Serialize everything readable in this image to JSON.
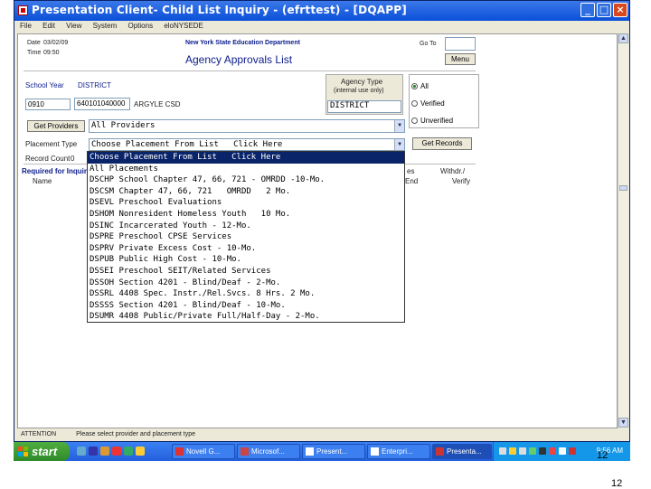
{
  "window": {
    "title": "Presentation Client- Child List Inquiry - (efrttest) - [DQAPP]",
    "menu": [
      "File",
      "Edit",
      "View",
      "System",
      "Options",
      "eloNYSEDE"
    ]
  },
  "header": {
    "date_label": "Date",
    "date_value": "03/02/09",
    "time_label": "Time",
    "time_value": "09:50",
    "department": "New York State Education Department",
    "page_title": "Agency Approvals List",
    "goto_label": "Go To",
    "goto_value": "",
    "menu_button": "Menu"
  },
  "selection": {
    "school_year_label": "School Year",
    "district_label": "DISTRICT",
    "school_year": "0910",
    "district_code": "640101040000",
    "district_name": "ARGYLE CSD",
    "agency_type_label": "Agency Type",
    "agency_type_sub": "(internal use only)",
    "agency_type_value": "DISTRICT",
    "get_providers_button": "Get Providers",
    "providers_value": "All Providers",
    "placement_type_label": "Placement Type",
    "placement_value": "Choose Placement From List   Click Here",
    "get_records_button": "Get Records",
    "record_count_label": "Record Count",
    "record_count": "0",
    "required_label": "Required for Inquiry",
    "name_col": "Name",
    "dates_col": "es",
    "end_col": "End",
    "withdraw_col": "Withdr./",
    "verify_col": "Verify"
  },
  "status_filter": {
    "options": [
      {
        "label": "All",
        "selected": true
      },
      {
        "label": "Verified",
        "selected": false
      },
      {
        "label": "Unverified",
        "selected": false
      }
    ]
  },
  "placement_list": [
    {
      "text": "Choose Placement From List   Click Here",
      "selected": true
    },
    {
      "text": "All Placements",
      "selected": false
    },
    {
      "text": "DSCHP School Chapter 47, 66, 721 - OMRDD -10-Mo.",
      "selected": false
    },
    {
      "text": "DSCSM Chapter 47, 66, 721   OMRDD   2 Mo.",
      "selected": false
    },
    {
      "text": "DSEVL Preschool Evaluations",
      "selected": false
    },
    {
      "text": "DSHOM Nonresident Homeless Youth   10 Mo.",
      "selected": false
    },
    {
      "text": "DSINC Incarcerated Youth - 12-Mo.",
      "selected": false
    },
    {
      "text": "DSPRE Preschool CPSE Services",
      "selected": false
    },
    {
      "text": "DSPRV Private Excess Cost - 10-Mo.",
      "selected": false
    },
    {
      "text": "DSPUB Public High Cost - 10-Mo.",
      "selected": false
    },
    {
      "text": "DSSEI Preschool SEIT/Related Services",
      "selected": false
    },
    {
      "text": "DSSOH Section 4201 - Blind/Deaf - 2-Mo.",
      "selected": false
    },
    {
      "text": "DSSRL 4408 Spec. Instr./Rel.Svcs. 8 Hrs. 2 Mo.",
      "selected": false
    },
    {
      "text": "DSSSS Section 4201 - Blind/Deaf - 10-Mo.",
      "selected": false
    },
    {
      "text": "DSUMR 4408 Public/Private Full/Half-Day - 2-Mo.",
      "selected": false
    }
  ],
  "statusbar": {
    "label": "ATTENTION",
    "message": "Please select provider and placement type"
  },
  "taskbar": {
    "start": "start",
    "items": [
      "Novell G...",
      "Microsof...",
      "Present...",
      "Enterpri...",
      "Presenta..."
    ],
    "clock": "9:56 AM"
  },
  "slide": {
    "number_inner": "12",
    "number_outer": "12"
  },
  "colors": {
    "titlebar": "#0a4fd8",
    "highlight": "#0a246a",
    "header_text": "#0b1c8c",
    "taskbar": "#245edc",
    "start": "#2f8a2a"
  }
}
